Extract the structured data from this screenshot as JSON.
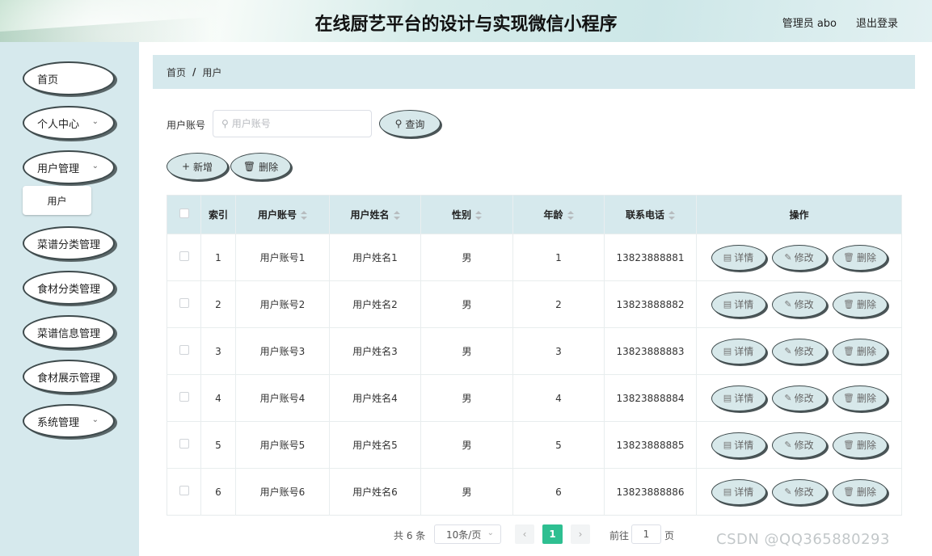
{
  "header": {
    "title": "在线厨艺平台的设计与实现微信小程序",
    "user": "管理员 abo",
    "logout": "退出登录"
  },
  "sidebar": {
    "items": [
      {
        "label": "首页",
        "has_children": false
      },
      {
        "label": "个人中心",
        "has_children": true
      },
      {
        "label": "用户管理",
        "has_children": true
      },
      {
        "label": "菜谱分类管理",
        "has_children": false
      },
      {
        "label": "食材分类管理",
        "has_children": false
      },
      {
        "label": "菜谱信息管理",
        "has_children": false
      },
      {
        "label": "食材展示管理",
        "has_children": false
      },
      {
        "label": "系统管理",
        "has_children": true
      }
    ],
    "submenu": {
      "label": "用户"
    }
  },
  "breadcrumb": {
    "home": "首页",
    "sep": "/",
    "current": "用户"
  },
  "search": {
    "label": "用户账号",
    "placeholder": "用户账号",
    "button": "查询"
  },
  "toolbar": {
    "add_label": "新增",
    "delete_label": "删除"
  },
  "table": {
    "columns": [
      "索引",
      "用户账号",
      "用户姓名",
      "性别",
      "年龄",
      "联系电话",
      "操作"
    ],
    "rows": [
      {
        "index": "1",
        "account": "用户账号1",
        "name": "用户姓名1",
        "gender": "男",
        "age": "1",
        "phone": "13823888881"
      },
      {
        "index": "2",
        "account": "用户账号2",
        "name": "用户姓名2",
        "gender": "男",
        "age": "2",
        "phone": "13823888882"
      },
      {
        "index": "3",
        "account": "用户账号3",
        "name": "用户姓名3",
        "gender": "男",
        "age": "3",
        "phone": "13823888883"
      },
      {
        "index": "4",
        "account": "用户账号4",
        "name": "用户姓名4",
        "gender": "男",
        "age": "4",
        "phone": "13823888884"
      },
      {
        "index": "5",
        "account": "用户账号5",
        "name": "用户姓名5",
        "gender": "男",
        "age": "5",
        "phone": "13823888885"
      },
      {
        "index": "6",
        "account": "用户账号6",
        "name": "用户姓名6",
        "gender": "男",
        "age": "6",
        "phone": "13823888886"
      }
    ],
    "actions": {
      "detail": "详情",
      "edit": "修改",
      "delete": "删除"
    }
  },
  "pagination": {
    "total": "共 6 条",
    "page_size": "10条/页",
    "current": "1",
    "goto_label": "前往",
    "goto_value": "1",
    "page_suffix": "页"
  },
  "watermark": "CSDN @QQ365880293",
  "colors": {
    "accent": "#2ebf91",
    "panel": "#d6e9ed",
    "button": "#d7e8ea"
  }
}
